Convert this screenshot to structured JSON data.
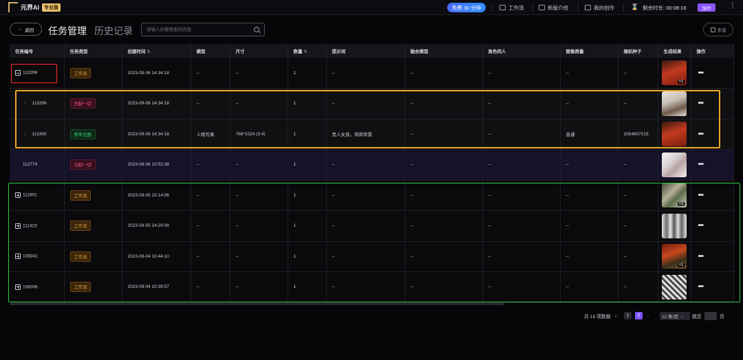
{
  "topbar": {
    "logo_text": "元界AI",
    "pro_badge": "专业版",
    "free_badge": "免费 30 分钟",
    "nav": [
      "工作流",
      "新版介绍",
      "我的创作"
    ],
    "timer_label": "剩余时长:",
    "timer_value": "00:08:18",
    "buy_label": "加时"
  },
  "header": {
    "back_label": "返回",
    "tab_active": "任务管理",
    "tab_inactive": "历史记录",
    "search_placeholder": "请输入你要搜索的内容",
    "multi_label": "多选"
  },
  "table": {
    "columns": [
      "任务编号",
      "任务类型",
      "创建时间",
      "模型",
      "尺寸",
      "数量",
      "提示词",
      "融合模型",
      "角色同人",
      "图像质量",
      "随机种子",
      "生成结果",
      "操作"
    ],
    "rows": [
      {
        "id": "113298",
        "type": "工作流",
        "type_kind": "workflow",
        "time": "2023-09-06 14:34:18",
        "model": "--",
        "size": "--",
        "qty": "1",
        "prompt": "--",
        "fusion": "--",
        "role": "--",
        "quality": "--",
        "seed": "--",
        "thumb": "red",
        "thumb_count": "+1",
        "expander": "minus",
        "row_kind": "parent"
      },
      {
        "id": "113299",
        "type": "分割一切",
        "type_kind": "split",
        "time": "2023-09-06 14:34:18",
        "model": "--",
        "size": "--",
        "qty": "1",
        "prompt": "--",
        "fusion": "--",
        "role": "--",
        "quality": "--",
        "seed": "--",
        "thumb": "coat",
        "thumb_count": "",
        "expander": "none",
        "row_kind": "sub"
      },
      {
        "id": "113300",
        "type": "条件生图",
        "type_kind": "cond",
        "time": "2023-09-06 14:34:18",
        "model": "人物写真",
        "size": "768*1024 (3:4)",
        "qty": "1",
        "prompt": "黑人女孩，简简背景",
        "fusion": "--",
        "role": "--",
        "quality": "普通",
        "seed": "1054807215",
        "thumb": "red",
        "thumb_count": "",
        "expander": "none",
        "row_kind": "sub"
      },
      {
        "id": "112774",
        "type": "分割一切",
        "type_kind": "split",
        "time": "2023-09-06 10:52:38",
        "model": "--",
        "size": "--",
        "qty": "1",
        "prompt": "--",
        "fusion": "--",
        "role": "--",
        "quality": "--",
        "seed": "--",
        "thumb": "sketch",
        "thumb_count": "",
        "expander": "none",
        "row_kind": "hl"
      },
      {
        "id": "111601",
        "type": "工作流",
        "type_kind": "workflow",
        "time": "2023-09-05 15:14:06",
        "model": "--",
        "size": "--",
        "qty": "1",
        "prompt": "--",
        "fusion": "--",
        "role": "--",
        "quality": "--",
        "seed": "--",
        "thumb": "wfA",
        "thumb_count": "+1",
        "expander": "plus",
        "row_kind": "parent"
      },
      {
        "id": "111423",
        "type": "工作流",
        "type_kind": "workflow",
        "time": "2023-09-05 14:29:08",
        "model": "--",
        "size": "--",
        "qty": "1",
        "prompt": "--",
        "fusion": "--",
        "role": "--",
        "quality": "--",
        "seed": "--",
        "thumb": "wfB",
        "thumb_count": "",
        "expander": "plus",
        "row_kind": "parent"
      },
      {
        "id": "108341",
        "type": "工作流",
        "type_kind": "workflow",
        "time": "2023-09-04 10:44:10",
        "model": "--",
        "size": "--",
        "qty": "1",
        "prompt": "--",
        "fusion": "--",
        "role": "--",
        "quality": "--",
        "seed": "--",
        "thumb": "wfC",
        "thumb_count": "+1",
        "expander": "plus",
        "row_kind": "parent"
      },
      {
        "id": "108306",
        "type": "工作流",
        "type_kind": "workflow",
        "time": "2023-09-04 10:39:57",
        "model": "--",
        "size": "--",
        "qty": "1",
        "prompt": "--",
        "fusion": "--",
        "role": "--",
        "quality": "--",
        "seed": "--",
        "thumb": "wfD",
        "thumb_count": "",
        "expander": "plus",
        "row_kind": "parent"
      }
    ]
  },
  "pagination": {
    "total": "共 18 项数据",
    "pages": [
      "1",
      "2"
    ],
    "current": "2",
    "page_size": "12 条/页",
    "jump_label": "跳至",
    "page_suffix": "页"
  }
}
